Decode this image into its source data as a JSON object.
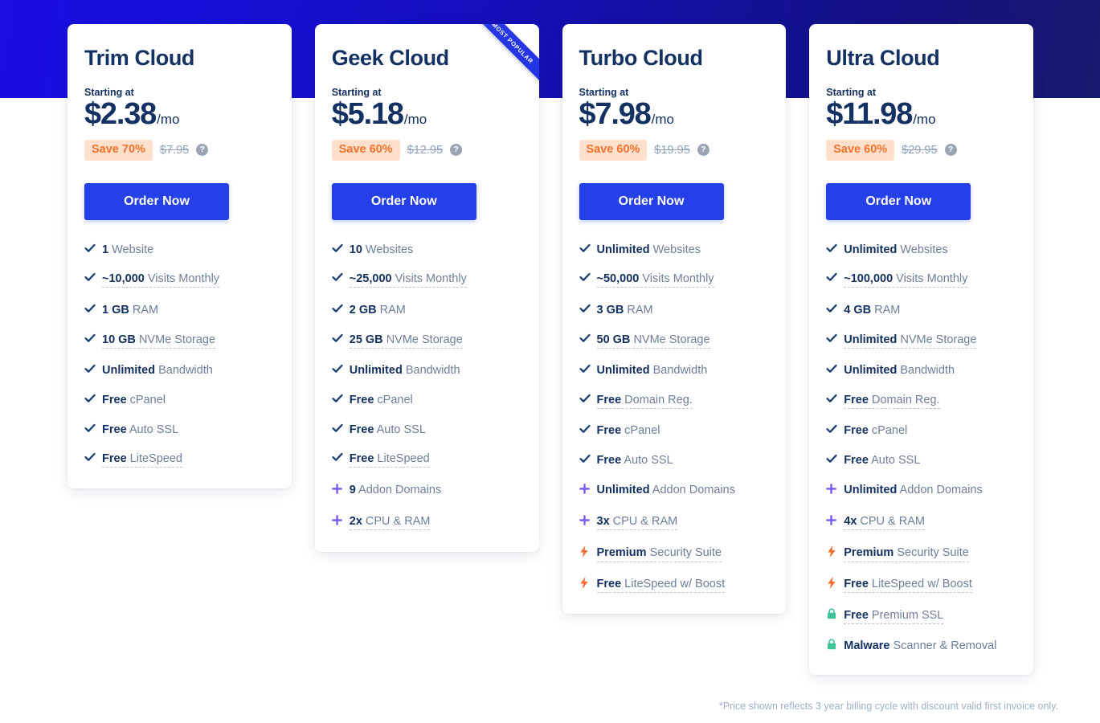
{
  "footnote": "*Price shown reflects 3 year billing cycle with discount valid first invoice only.",
  "colors": {
    "brand_blue": "#2540e8",
    "navy_text": "#133163",
    "muted_text": "#6d7f9c",
    "save_badge_bg": "#ffe0cc",
    "save_badge_text": "#f4722b",
    "check_icon": "#173f72",
    "plus_icon": "#7c5cf0",
    "bolt_icon": "#f96a2c",
    "lock_icon": "#3fc49a"
  },
  "labels": {
    "starting_at": "Starting at",
    "order_now": "Order Now",
    "popular_ribbon": "MOST POPULAR",
    "help_glyph": "?",
    "check_glyph": "✔",
    "plus_glyph": "✚",
    "bolt_glyph": "⚡",
    "lock_glyph": "🔒"
  },
  "plans": [
    {
      "name": "Trim Cloud",
      "price": "$2.38",
      "period": "/mo",
      "save": "Save 70%",
      "old_price": "$7.95",
      "popular": false,
      "features": [
        {
          "icon": "check",
          "bold": "1",
          "rest": " Website",
          "tip": false
        },
        {
          "icon": "check",
          "bold": "~10,000",
          "rest": " Visits Monthly",
          "tip": true
        },
        {
          "icon": "check",
          "bold": "1 GB",
          "rest": " RAM",
          "tip": false
        },
        {
          "icon": "check",
          "bold": "10 GB",
          "rest": " NVMe Storage",
          "tip": true
        },
        {
          "icon": "check",
          "bold": "Unlimited",
          "rest": " Bandwidth",
          "tip": false
        },
        {
          "icon": "check",
          "bold": "Free",
          "rest": " cPanel",
          "tip": false
        },
        {
          "icon": "check",
          "bold": "Free",
          "rest": " Auto SSL",
          "tip": false
        },
        {
          "icon": "check",
          "bold": "Free",
          "rest": " LiteSpeed",
          "tip": true
        }
      ]
    },
    {
      "name": "Geek Cloud",
      "price": "$5.18",
      "period": "/mo",
      "save": "Save 60%",
      "old_price": "$12.95",
      "popular": true,
      "features": [
        {
          "icon": "check",
          "bold": "10",
          "rest": " Websites",
          "tip": false
        },
        {
          "icon": "check",
          "bold": "~25,000",
          "rest": " Visits Monthly",
          "tip": true
        },
        {
          "icon": "check",
          "bold": "2 GB",
          "rest": " RAM",
          "tip": false
        },
        {
          "icon": "check",
          "bold": "25 GB",
          "rest": " NVMe Storage",
          "tip": true
        },
        {
          "icon": "check",
          "bold": "Unlimited",
          "rest": " Bandwidth",
          "tip": false
        },
        {
          "icon": "check",
          "bold": "Free",
          "rest": " cPanel",
          "tip": false
        },
        {
          "icon": "check",
          "bold": "Free",
          "rest": " Auto SSL",
          "tip": false
        },
        {
          "icon": "check",
          "bold": "Free",
          "rest": " LiteSpeed",
          "tip": true
        },
        {
          "icon": "plus",
          "bold": "9",
          "rest": " Addon Domains",
          "tip": false
        },
        {
          "icon": "plus",
          "bold": "2x",
          "rest": " CPU & RAM",
          "tip": true
        }
      ]
    },
    {
      "name": "Turbo Cloud",
      "price": "$7.98",
      "period": "/mo",
      "save": "Save 60%",
      "old_price": "$19.95",
      "popular": false,
      "features": [
        {
          "icon": "check",
          "bold": "Unlimited",
          "rest": " Websites",
          "tip": false
        },
        {
          "icon": "check",
          "bold": "~50,000",
          "rest": " Visits Monthly",
          "tip": true
        },
        {
          "icon": "check",
          "bold": "3 GB",
          "rest": " RAM",
          "tip": false
        },
        {
          "icon": "check",
          "bold": "50 GB",
          "rest": " NVMe Storage",
          "tip": true
        },
        {
          "icon": "check",
          "bold": "Unlimited",
          "rest": " Bandwidth",
          "tip": false
        },
        {
          "icon": "check",
          "bold": "Free",
          "rest": " Domain Reg.",
          "tip": true
        },
        {
          "icon": "check",
          "bold": "Free",
          "rest": " cPanel",
          "tip": false
        },
        {
          "icon": "check",
          "bold": "Free",
          "rest": " Auto SSL",
          "tip": false
        },
        {
          "icon": "plus",
          "bold": "Unlimited",
          "rest": " Addon Domains",
          "tip": false
        },
        {
          "icon": "plus",
          "bold": "3x",
          "rest": " CPU & RAM",
          "tip": true
        },
        {
          "icon": "bolt",
          "bold": "Premium",
          "rest": " Security Suite",
          "tip": true
        },
        {
          "icon": "bolt",
          "bold": "Free",
          "rest": " LiteSpeed w/ Boost",
          "tip": true
        }
      ]
    },
    {
      "name": "Ultra Cloud",
      "price": "$11.98",
      "period": "/mo",
      "save": "Save 60%",
      "old_price": "$29.95",
      "popular": false,
      "features": [
        {
          "icon": "check",
          "bold": "Unlimited",
          "rest": " Websites",
          "tip": false
        },
        {
          "icon": "check",
          "bold": "~100,000",
          "rest": " Visits Monthly",
          "tip": true
        },
        {
          "icon": "check",
          "bold": "4 GB",
          "rest": " RAM",
          "tip": false
        },
        {
          "icon": "check",
          "bold": "Unlimited",
          "rest": " NVMe Storage",
          "tip": true
        },
        {
          "icon": "check",
          "bold": "Unlimited",
          "rest": " Bandwidth",
          "tip": false
        },
        {
          "icon": "check",
          "bold": "Free",
          "rest": " Domain Reg.",
          "tip": true
        },
        {
          "icon": "check",
          "bold": "Free",
          "rest": " cPanel",
          "tip": false
        },
        {
          "icon": "check",
          "bold": "Free",
          "rest": " Auto SSL",
          "tip": false
        },
        {
          "icon": "plus",
          "bold": "Unlimited",
          "rest": " Addon Domains",
          "tip": false
        },
        {
          "icon": "plus",
          "bold": "4x",
          "rest": " CPU & RAM",
          "tip": true
        },
        {
          "icon": "bolt",
          "bold": "Premium",
          "rest": " Security Suite",
          "tip": true
        },
        {
          "icon": "bolt",
          "bold": "Free",
          "rest": " LiteSpeed w/ Boost",
          "tip": true
        },
        {
          "icon": "lock",
          "bold": "Free",
          "rest": " Premium SSL",
          "tip": true
        },
        {
          "icon": "lock",
          "bold": "Malware",
          "rest": " Scanner & Removal",
          "tip": false
        }
      ]
    }
  ]
}
